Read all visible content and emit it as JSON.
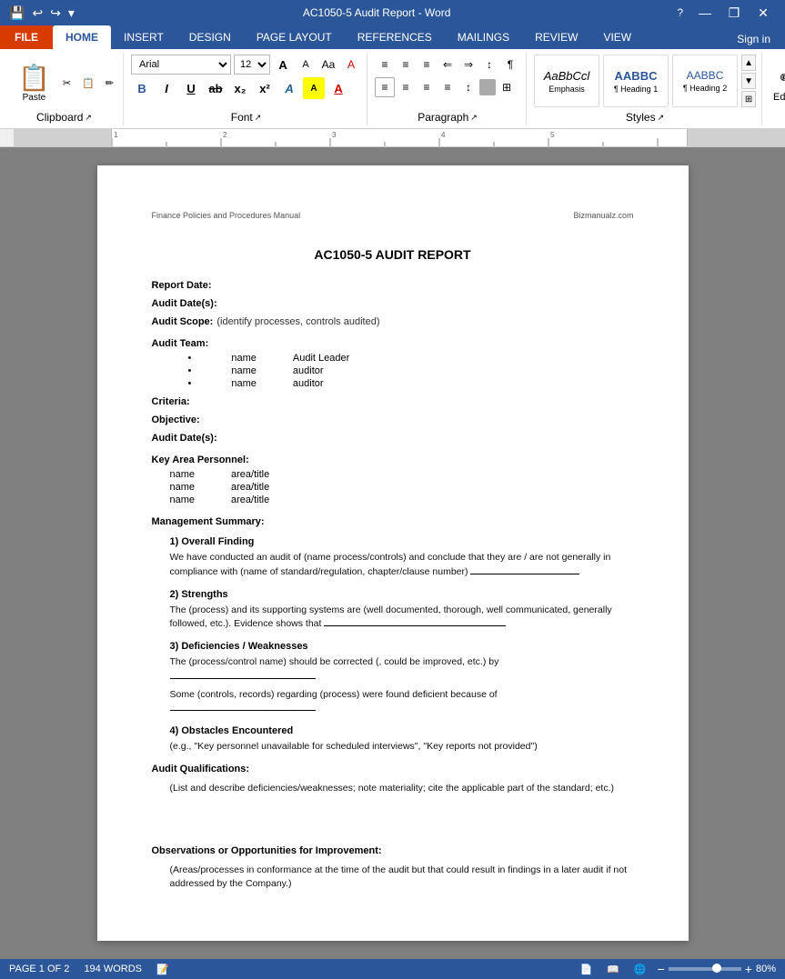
{
  "titleBar": {
    "title": "AC1050-5 Audit Report - Word",
    "helpBtn": "?",
    "minimizeBtn": "—",
    "restoreBtn": "❐",
    "closeBtn": "✕",
    "quickAccess": [
      "💾",
      "↩",
      "↪",
      "▾"
    ]
  },
  "ribbon": {
    "tabs": [
      "FILE",
      "HOME",
      "INSERT",
      "DESIGN",
      "PAGE LAYOUT",
      "REFERENCES",
      "MAILINGS",
      "REVIEW",
      "VIEW"
    ],
    "activeTab": "HOME",
    "fileTab": "FILE",
    "signIn": "Sign in",
    "editing": "Editing",
    "groups": {
      "clipboard": {
        "label": "Clipboard",
        "pasteLabel": "Paste",
        "subItems": [
          "✂",
          "📋",
          "✏"
        ]
      },
      "font": {
        "label": "Font",
        "fontName": "Arial",
        "fontSize": "12",
        "sizeUpBtn": "A",
        "sizeDownBtn": "A",
        "clearBtn": "A",
        "formatBtns": [
          "B",
          "I",
          "U",
          "ab",
          "x₂",
          "x²"
        ],
        "colorBtns": [
          "A",
          "A",
          "A"
        ]
      },
      "paragraph": {
        "label": "Paragraph",
        "row1Btns": [
          "≡",
          "≡",
          "≡",
          "≡",
          "≡",
          "≡",
          "≡",
          "≡"
        ],
        "row2Btns": [
          "≡",
          "≡",
          "≡",
          "≡",
          "↕",
          "¶"
        ],
        "row3Btns": [
          "⬛",
          "⬛",
          "⬛",
          "⬛"
        ]
      },
      "styles": {
        "label": "Styles",
        "items": [
          {
            "name": "Default",
            "label": "AaBbCcl",
            "sublabel": "Emphasis"
          },
          {
            "name": "Heading1",
            "label": "AABBC",
            "sublabel": "¶ Heading 1"
          },
          {
            "name": "Heading2",
            "label": "AABBC",
            "sublabel": "¶ Heading 2"
          }
        ]
      }
    }
  },
  "document": {
    "headerLeft": "Finance Policies and Procedures Manual",
    "headerRight": "Bizmanualz.com",
    "title": "AC1050-5 AUDIT REPORT",
    "fields": [
      {
        "label": "Report Date:",
        "value": ""
      },
      {
        "label": "Audit Date(s):",
        "value": ""
      },
      {
        "label": "Audit Scope:",
        "value": "(identify processes, controls audited)"
      }
    ],
    "auditTeam": {
      "label": "Audit Team:",
      "members": [
        {
          "name": "name",
          "role": "Audit Leader"
        },
        {
          "name": "name",
          "role": "auditor"
        },
        {
          "name": "name",
          "role": "auditor"
        }
      ]
    },
    "criteria": {
      "label": "Criteria:",
      "value": ""
    },
    "objective": {
      "label": "Objective:",
      "value": ""
    },
    "auditDate2": {
      "label": "Audit Date(s):",
      "value": ""
    },
    "keyPersonnel": {
      "label": "Key Area Personnel:",
      "members": [
        {
          "name": "name",
          "role": "area/title"
        },
        {
          "name": "name",
          "role": "area/title"
        },
        {
          "name": "name",
          "role": "area/title"
        }
      ]
    },
    "managementSummary": {
      "label": "Management Summary:",
      "sections": [
        {
          "title": "1) Overall Finding",
          "text": "We have conducted an audit of (name process/controls) and conclude that they are / are not generally in compliance with (name of standard/regulation, chapter/clause number)"
        },
        {
          "title": "2) Strengths",
          "text": "The (process) and its supporting systems are (well documented, thorough, well communicated, generally followed, etc.).  Evidence shows that"
        },
        {
          "title": "3) Deficiencies / Weaknesses",
          "lines": [
            "The (process/control name) should be corrected (, could be improved, etc.) by",
            "Some (controls, records) regarding (process) were found deficient because of"
          ]
        },
        {
          "title": "4) Obstacles Encountered",
          "text": "(e.g., \"Key personnel unavailable for scheduled interviews\", \"Key reports not provided\")"
        }
      ]
    },
    "auditQualifications": {
      "label": "Audit Qualifications:",
      "text": "(List and describe deficiencies/weaknesses; note materiality; cite the applicable part of the standard; etc.)"
    },
    "observations": {
      "label": "Observations or Opportunities for Improvement:",
      "text": "(Areas/processes in conformance at the time of the audit but that could result in findings in a later audit if not addressed by the Company.)"
    }
  },
  "statusBar": {
    "pageInfo": "PAGE 1 OF 2",
    "wordCount": "194 WORDS",
    "zoom": "80%",
    "zoomMinus": "−",
    "zoomPlus": "+"
  }
}
